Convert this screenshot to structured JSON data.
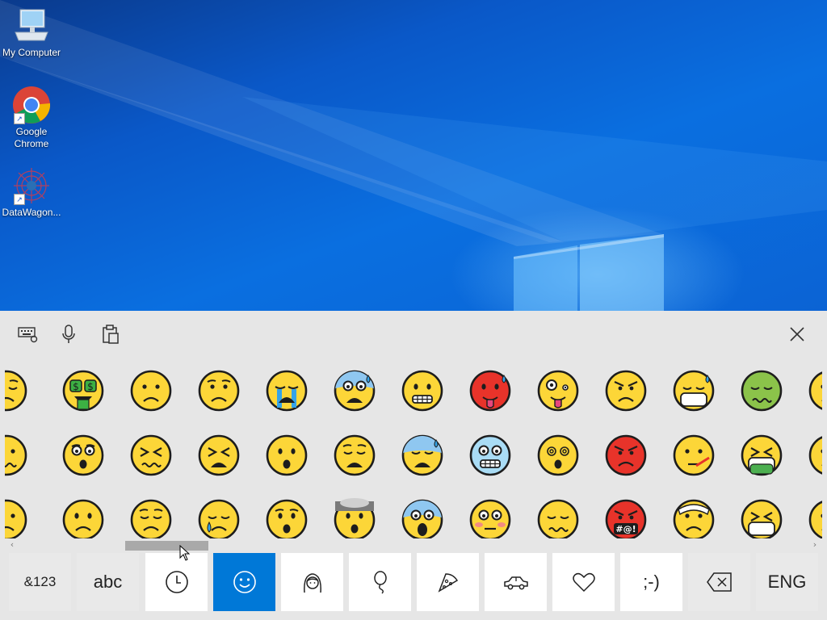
{
  "desktop": {
    "icons": [
      {
        "label": "My Computer",
        "icon": "computer-icon"
      },
      {
        "label": "Google Chrome",
        "label_lines": [
          "Google",
          "Chrome"
        ],
        "icon": "chrome-icon",
        "shortcut": true
      },
      {
        "label": "DataWagon...",
        "icon": "datawagon-icon",
        "shortcut": true
      }
    ]
  },
  "keyboard": {
    "toolbar": {
      "keyboard_settings_icon": "keyboard-icon",
      "dictation_icon": "microphone-icon",
      "clipboard_icon": "clipboard-icon",
      "close_icon": "close-icon"
    },
    "emoji_grid": {
      "rows": [
        [
          "pensive",
          "money-mouth",
          "slightly-frowning",
          "worried",
          "loudly-crying",
          "anxious-sweat",
          "grimacing",
          "hot-face",
          "zany",
          "angry",
          "sweat-mask",
          "nauseated",
          "partial"
        ],
        [
          "confused",
          "hushed",
          "confounded",
          "tired",
          "frowning-open",
          "disappointed",
          "fearful-sweat",
          "cold-face",
          "dizzy",
          "pouting",
          "thermometer",
          "vomiting",
          "partial"
        ],
        [
          "partial",
          "frowning",
          "pensive",
          "sad-tear",
          "hushed-open",
          "exploding-head",
          "screaming",
          "flushed",
          "woozy",
          "cursing",
          "bandage",
          "persevering-mask",
          "partial"
        ]
      ]
    },
    "scrollbar": {
      "left_arrow": "‹",
      "right_arrow": "›",
      "position": 0.15
    },
    "bottom_keys": [
      {
        "label": "&123",
        "type": "text"
      },
      {
        "label": "abc",
        "type": "text"
      },
      {
        "icon": "recent-clock-icon",
        "type": "icon"
      },
      {
        "icon": "smiley-icon",
        "type": "icon",
        "active": true
      },
      {
        "icon": "person-icon",
        "type": "icon"
      },
      {
        "icon": "balloon-icon",
        "type": "icon"
      },
      {
        "icon": "pizza-icon",
        "type": "icon"
      },
      {
        "icon": "car-icon",
        "type": "icon"
      },
      {
        "icon": "heart-icon",
        "type": "icon"
      },
      {
        "label": ";-)",
        "type": "text"
      },
      {
        "icon": "backspace-icon",
        "type": "icon"
      },
      {
        "label": "ENG",
        "type": "text"
      }
    ],
    "accent_color": "#0078d7"
  }
}
